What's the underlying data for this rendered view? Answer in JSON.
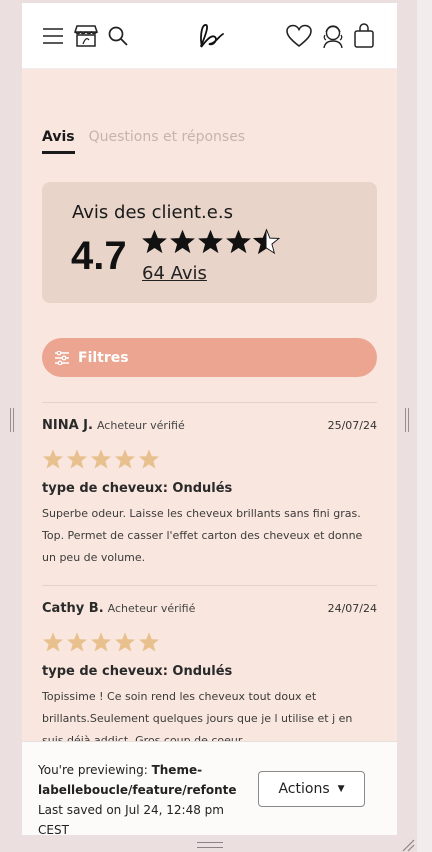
{
  "header": {
    "icons": [
      "menu-icon",
      "store-icon",
      "search-icon",
      "logo",
      "heart-icon",
      "account-icon",
      "cart-icon"
    ],
    "logo_text": "lb"
  },
  "tabs": [
    {
      "label": "Avis",
      "active": true
    },
    {
      "label": "Questions et réponses",
      "active": false
    }
  ],
  "summary": {
    "title": "Avis des client.e.s",
    "score": "4.7",
    "rating": 4.7,
    "count_label": "64 Avis"
  },
  "filter": {
    "label": "Filtres"
  },
  "reviews": [
    {
      "name": "NINA J.",
      "badge": "Acheteur vérifié",
      "date": "25/07/24",
      "stars": 5,
      "type": "type de cheveux: Ondulés",
      "text": "Superbe odeur. Laisse les cheveux brillants sans fini gras. Top. Permet de casser l'effet carton des cheveux et donne un peu de volume."
    },
    {
      "name": "Cathy B.",
      "badge": "Acheteur vérifié",
      "date": "24/07/24",
      "stars": 5,
      "type": "type de cheveux: Ondulés",
      "text": "Topissime ! Ce soin rend les cheveux tout doux et brillants.Seulement quelques jours que je l utilise et j en suis déjà addict. Gros coup de coeur"
    }
  ],
  "preview": {
    "prefix": "You're previewing: ",
    "theme": "Theme-labelleboucle/feature/refonte",
    "saved": "Last saved on Jul 24, 12:48 pm CEST",
    "actions_label": "Actions"
  },
  "colors": {
    "page_bg": "#f9e7df",
    "summary_bg": "#e8d4c9",
    "filter_bg": "#eba591",
    "star_gold": "#e8c08e",
    "star_dark": "#111111"
  }
}
